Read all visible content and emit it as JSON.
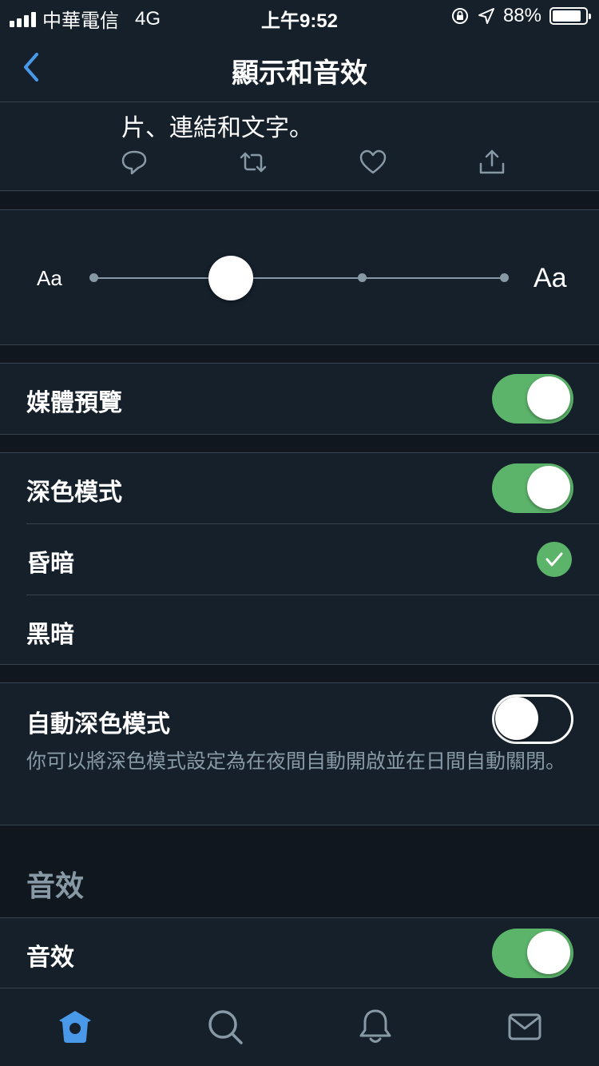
{
  "status_bar": {
    "carrier": "中華電信",
    "network": "4G",
    "time": "上午9:52",
    "battery": "88%",
    "battery_level": 0.88
  },
  "nav": {
    "title": "顯示和音效",
    "back_icon": "chevron-left-icon"
  },
  "preview": {
    "text": "片、連結和文字。",
    "actions": [
      "reply-icon",
      "retweet-icon",
      "like-icon",
      "share-icon"
    ]
  },
  "font_size": {
    "small_label": "Aa",
    "large_label": "Aa",
    "steps": 4,
    "selected_step": 1
  },
  "media_preview": {
    "label": "媒體預覽",
    "enabled": true
  },
  "dark_mode": {
    "label": "深色模式",
    "enabled": true,
    "options": [
      {
        "label": "昏暗",
        "selected": true
      },
      {
        "label": "黑暗",
        "selected": false
      }
    ]
  },
  "auto_dark": {
    "label": "自動深色模式",
    "enabled": false,
    "description": "你可以將深色模式設定為在夜間自動開啟並在日間自動關閉。"
  },
  "sound": {
    "section_title": "音效",
    "label": "音效",
    "enabled": true
  },
  "tabs": [
    "home-icon",
    "search-icon",
    "notifications-icon",
    "messages-icon"
  ],
  "colors": {
    "background": "#15202b",
    "accent": "#4a99e9",
    "toggle_on": "#5cb46a",
    "secondary_text": "#8899a6"
  }
}
